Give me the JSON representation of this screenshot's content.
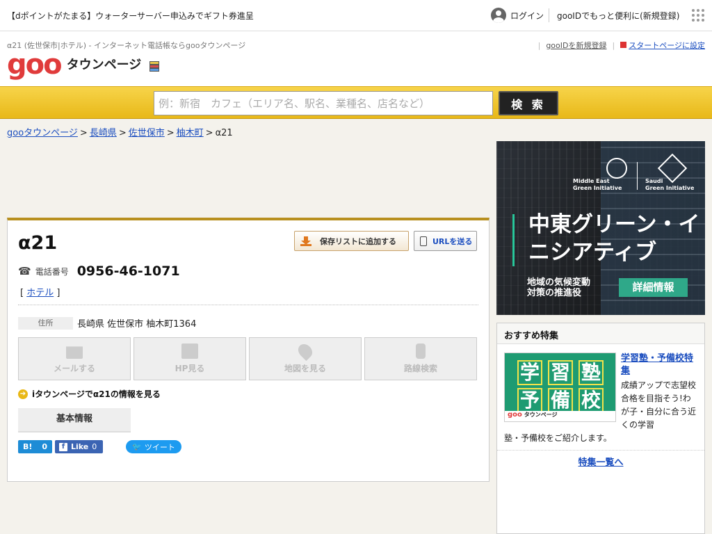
{
  "topbar": {
    "promo": "【dポイントがたまる】ウォーターサーバー申込みでギフト券進呈",
    "login": "ログイン",
    "register": "gooIDでもっと便利に(新規登録)"
  },
  "header": {
    "subtitle": "α21 (佐世保市|ホテル) - インターネット電話帳ならgooタウンページ",
    "logo_goo": "goo",
    "logo_text": "タウンページ",
    "link_new_id": "gooIDを新規登録",
    "link_startpage": "スタートページに設定"
  },
  "search": {
    "placeholder": "例：新宿　カフェ（エリア名、駅名、業種名、店名など）",
    "button": "検 索"
  },
  "breadcrumb": [
    "gooタウンページ",
    "長崎県",
    "佐世保市",
    "柚木町",
    "α21"
  ],
  "listing": {
    "name": "α21",
    "save_button": "保存リストに追加する",
    "url_button": "URLを送る",
    "tel_label": "電話番号",
    "tel": "0956-46-1071",
    "category_open": "[ ",
    "category": "ホテル",
    "category_close": " ]",
    "address_label": "住所",
    "address": "長崎県 佐世保市 柚木町1364",
    "actions": [
      {
        "label": "メールする",
        "icon": "mail-icon"
      },
      {
        "label": "HP見る",
        "icon": "document-icon"
      },
      {
        "label": "地図を見る",
        "icon": "map-pin-icon"
      },
      {
        "label": "路線検索",
        "icon": "train-icon"
      }
    ],
    "itownpage_link": "iタウンページでα21の情報を見る",
    "tab_basic": "基本情報"
  },
  "social": {
    "hatena_label": "B!",
    "hatena_count": "0",
    "fb_label": "Like",
    "fb_count": "0",
    "tweet": "ツイート"
  },
  "ad": {
    "org_left": "Middle East\nGreen Initiative",
    "org_right": "Saudi\nGreen Initiative",
    "headline": "中東グリーン・イニシアティブ",
    "sub": "地域の気候変動\n対策の推進役",
    "cta": "詳細情報"
  },
  "featured": {
    "heading": "おすすめ特集",
    "thumb_chars": [
      "学",
      "習",
      "塾",
      "予",
      "備",
      "校"
    ],
    "thumb_footer_goo": "goo",
    "thumb_footer_text": "タウンページ",
    "title": "学習塾・予備校特集",
    "desc": "成績アップで志望校合格を目指そう!わが子・自分に合う近くの学習",
    "desc2": "塾・予備校をご紹介します。",
    "more": "特集一覧へ"
  },
  "colors": {
    "accent_yellow": "#e8b818",
    "link_blue": "#1a4dbf",
    "goo_red": "#e03b3b"
  }
}
